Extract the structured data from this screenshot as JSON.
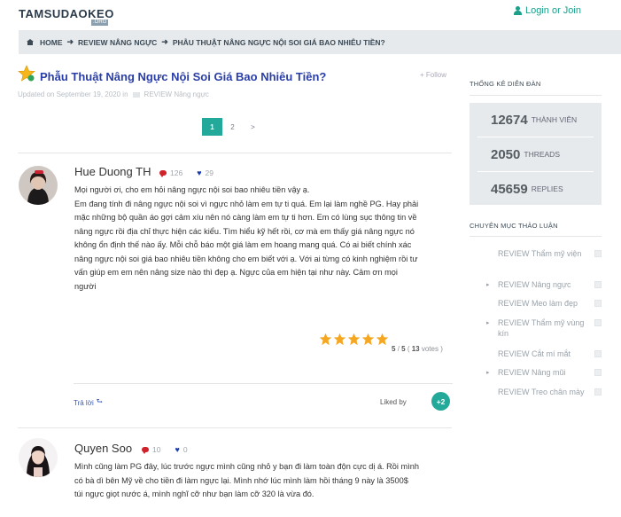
{
  "header": {
    "logo": "TAMSUDAOKEO",
    "logo_sub": ".ORG",
    "login": "Login or Join"
  },
  "breadcrumb": {
    "items": [
      "HOME",
      "REVIEW NÂNG NGỰC",
      "PHẪU THUẬT NÂNG NGỰC NỘI SOI GIÁ BAO NHIÊU TIỀN?"
    ]
  },
  "thread": {
    "title": "Phẫu Thuật Nâng Ngực Nội Soi Giá Bao Nhiêu Tiền?",
    "follow": "Follow",
    "meta_prefix": "Updated on September 19, 2020 in",
    "meta_category": "REVIEW Nâng ngực"
  },
  "pagination": {
    "pages": [
      "1",
      "2",
      ">"
    ],
    "active": "1"
  },
  "posts": [
    {
      "author": "Hue Duong TH",
      "comments": "126",
      "likes": "29",
      "lines": [
        "Mọi người ơi, cho em hỏi nâng ngực nội soi bao nhiêu tiền vậy ạ.",
        "Em đang tính đi nâng ngực nội soi vì ngực nhỏ làm em tự ti quá. Em lại làm nghề PG. Hay phải",
        "mặc những bộ quần áo gợi cảm xíu nên nó càng làm em tự ti hơn. Em có lùng sục thông tin về",
        "nâng ngực rồi địa chỉ thực hiện các kiểu. Tìm hiểu kỹ hết rồi, cơ mà em thấy giá nâng ngực nó",
        "không ổn định thế nào ấy. Mỗi chỗ báo một giá làm em hoang mang quá. Có ai biết chính xác",
        "nâng ngực nội soi giá bao nhiêu tiền không cho em biết với ạ. Với ai từng có kinh nghiệm rồi tư",
        "vấn giúp em em nên nâng size nào thì đẹp ạ. Ngực của em hiện tại như này. Cảm ơn mọi",
        "người"
      ],
      "rating": {
        "score": "5",
        "max": "5",
        "votes": "13",
        "votes_label": "votes",
        "stars": 5
      },
      "reply": "Trả lời",
      "liked_by": "Liked by",
      "liked_more": "+2"
    },
    {
      "author": "Quyen Soo",
      "comments": "10",
      "likes": "0",
      "lines": [
        "Mình cũng làm PG đây, lúc trước ngực mình cũng nhỏ y bạn đi làm toàn độn cực dị á. Rồi mình",
        "có bà dì bên Mỹ về cho tiền đi làm ngực lại. Mình nhớ lúc mình làm hồi tháng 9 này là 3500$",
        "túi ngực giọt nước á, mình nghĩ cỡ như bạn làm cỡ 320 là vừa đó."
      ]
    }
  ],
  "sidebar": {
    "stats_heading": "THỐNG KÊ DIỄN ĐÀN",
    "stats": [
      {
        "num": "12674",
        "label": "THÀNH VIÊN"
      },
      {
        "num": "2050",
        "label": "THREADS"
      },
      {
        "num": "45659",
        "label": "REPLIES"
      }
    ],
    "cat_heading": "CHUYÊN MỤC THẢO LUẬN",
    "categories": [
      {
        "label": "REVIEW Thẩm mỹ viện",
        "bullet": false
      },
      {
        "label": "REVIEW Nâng ngực",
        "bullet": true
      },
      {
        "label": "REVIEW Meo làm đẹp",
        "bullet": false
      },
      {
        "label": "REVIEW Thẩm mỹ vùng kín",
        "bullet": true
      },
      {
        "label": "REVIEW Cắt mí mắt",
        "bullet": false
      },
      {
        "label": "REVIEW Nâng mũi",
        "bullet": true
      },
      {
        "label": "REVIEW Treo chân mày",
        "bullet": false
      }
    ]
  },
  "colors": {
    "accent": "#22a99a",
    "title": "#2a3ea8",
    "breadcrumb_bg": "#e6eaec",
    "star": "#f5a623"
  }
}
